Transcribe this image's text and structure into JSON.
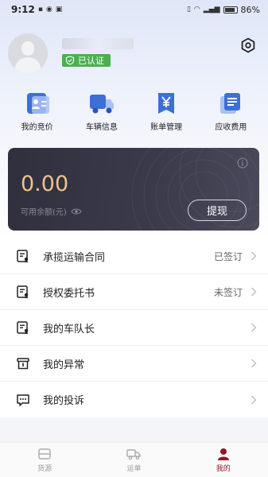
{
  "status_bar": {
    "time": "9:12",
    "battery": "86%"
  },
  "profile": {
    "verified_label": "已认证"
  },
  "quick_menu": [
    {
      "label": "我的竞价",
      "icon": "bid-icon"
    },
    {
      "label": "车辆信息",
      "icon": "truck-icon"
    },
    {
      "label": "账单管理",
      "icon": "bill-icon"
    },
    {
      "label": "应收费用",
      "icon": "receivable-icon"
    }
  ],
  "wallet": {
    "balance": "0.00",
    "balance_label": "可用余额(元)",
    "withdraw_label": "提现"
  },
  "menu_list": [
    {
      "label": "承揽运输合同",
      "status": "已签订"
    },
    {
      "label": "授权委托书",
      "status": "未签订"
    },
    {
      "label": "我的车队长",
      "status": ""
    },
    {
      "label": "我的异常",
      "status": ""
    },
    {
      "label": "我的投诉",
      "status": ""
    }
  ],
  "tabbar": [
    {
      "label": "货源",
      "active": false
    },
    {
      "label": "运单",
      "active": false
    },
    {
      "label": "我的",
      "active": true
    }
  ],
  "colors": {
    "accent": "#8b1a2b",
    "balance": "#f0c28a",
    "verified": "#4caf50",
    "icon_blue": "#3d6fd8"
  }
}
